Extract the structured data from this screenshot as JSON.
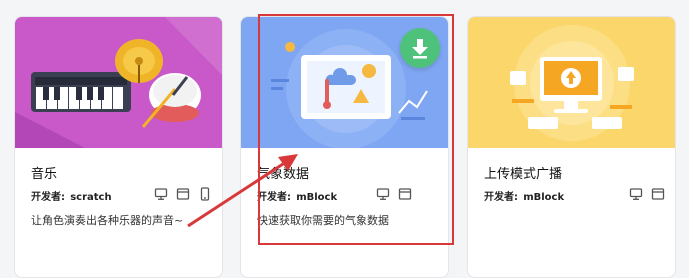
{
  "colors": {
    "card1_banner": "#c959c9",
    "card2_banner": "#7fa6f2",
    "card3_banner": "#fbd76b",
    "download_button": "#4ec27a",
    "annotation_red": "#d9383a"
  },
  "cards": [
    {
      "title": "音乐",
      "developer_label": "开发者:",
      "developer": "scratch",
      "description": "让角色演奏出各种乐器的声音~",
      "icons": [
        "monitor-icon",
        "browser-window-icon",
        "mobile-phone-icon"
      ]
    },
    {
      "title": "气象数据",
      "developer_label": "开发者:",
      "developer": "mBlock",
      "description": "快速获取你需要的气象数据",
      "icons": [
        "monitor-icon",
        "browser-window-icon"
      ],
      "download_icon": "download-icon"
    },
    {
      "title": "上传模式广播",
      "developer_label": "开发者:",
      "developer": "mBlock",
      "description": "",
      "icons": [
        "monitor-icon",
        "browser-window-icon"
      ]
    }
  ]
}
